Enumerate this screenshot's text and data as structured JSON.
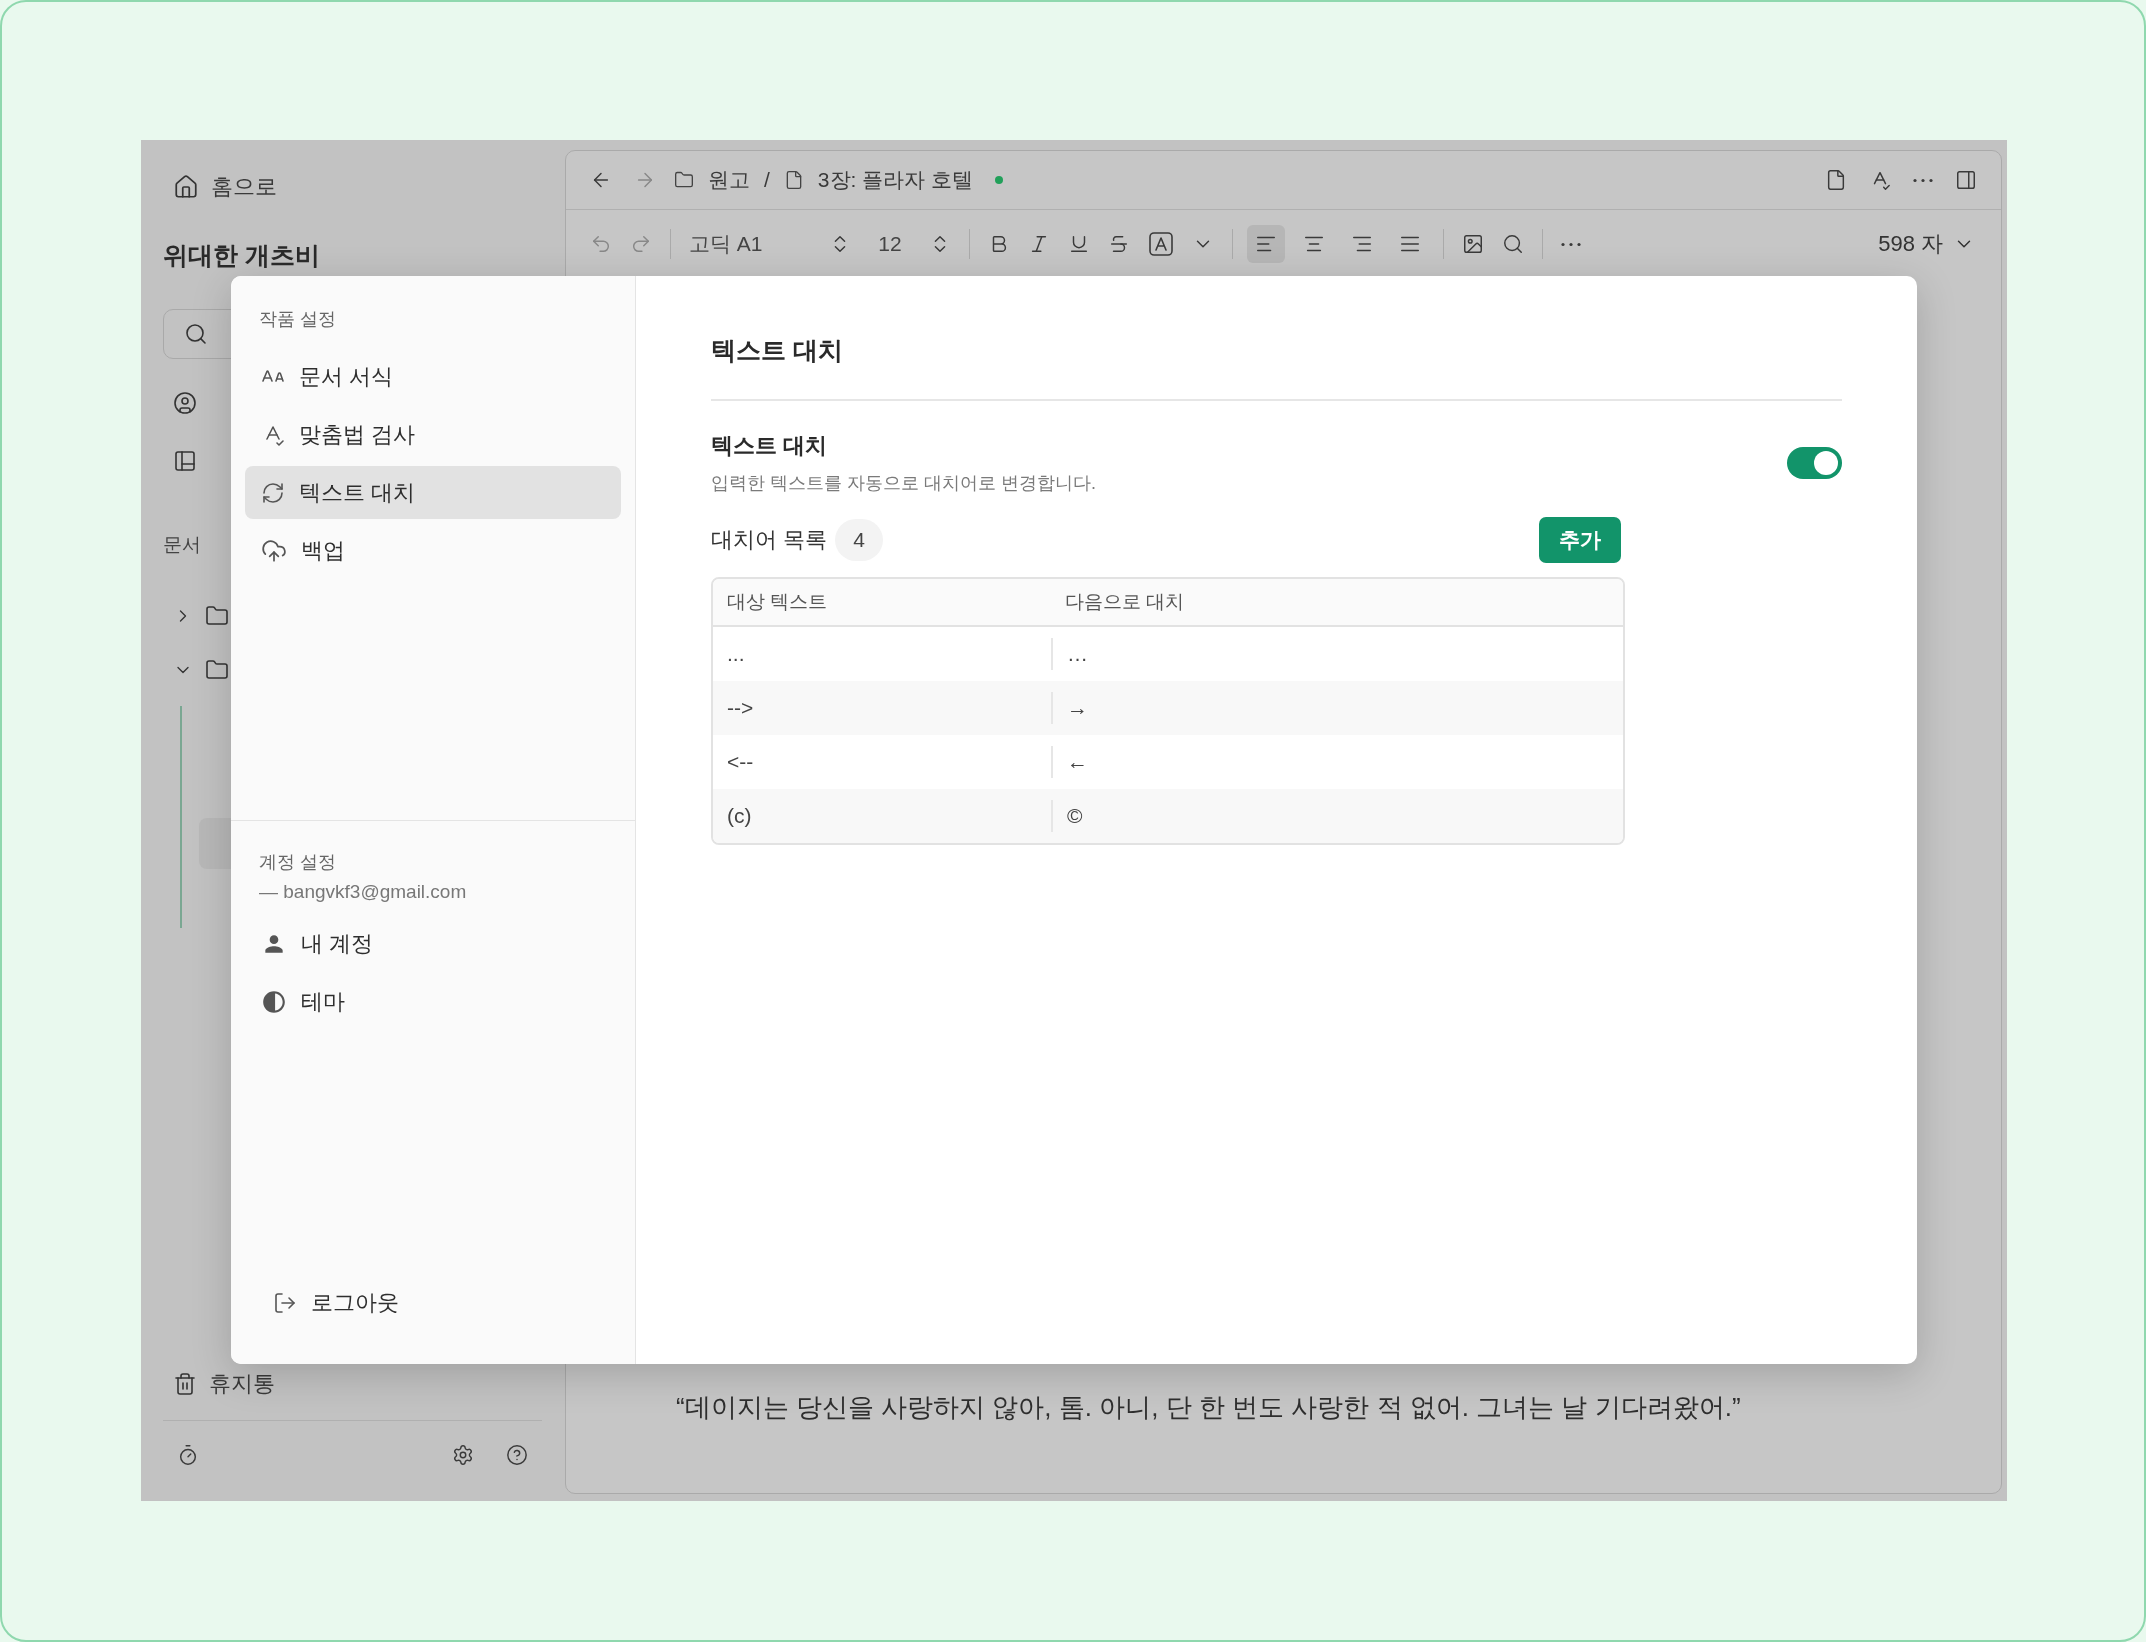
{
  "sidebar": {
    "home_label": "홈으로",
    "project_title": "위대한 개츠비",
    "section_label": "문서",
    "trash_label": "휴지통"
  },
  "editor": {
    "breadcrumb": [
      {
        "kind": "folder",
        "label": "원고"
      },
      {
        "kind": "file",
        "label": "3장: 플라자 호텔"
      }
    ],
    "breadcrumb_separator": "/",
    "saved": true,
    "toolbar": {
      "font": "고딕 A1",
      "size": "12",
      "alignments": [
        {
          "kind": "left",
          "selected": true
        },
        {
          "kind": "center",
          "selected": false
        },
        {
          "kind": "right",
          "selected": false
        },
        {
          "kind": "justify",
          "selected": false
        }
      ]
    },
    "word_count": "598 자",
    "body_text": "“데이지는 당신을 사랑하지 않아, 톰. 아니, 단 한 번도 사랑한 적 없어. 그녀는 날 기다려왔어.”"
  },
  "settings": {
    "work_heading": "작품 설정",
    "work_items": [
      {
        "kind": "format",
        "label": "문서 서식",
        "selected": false
      },
      {
        "kind": "spellcheck",
        "label": "맞춤법 검사",
        "selected": false
      },
      {
        "kind": "replace",
        "label": "텍스트 대치",
        "selected": true
      },
      {
        "kind": "backup",
        "label": "백업",
        "selected": false
      }
    ],
    "account_heading": "계정 설정",
    "account_email": "— bangvkf3@gmail.com",
    "account_items": [
      {
        "kind": "account",
        "label": "내 계정",
        "selected": false
      },
      {
        "kind": "theme",
        "label": "테마",
        "selected": false
      }
    ],
    "logout_label": "로그아웃",
    "page": {
      "title": "텍스트 대치",
      "setting_title": "텍스트 대치",
      "setting_description": "입력한 텍스트를 자동으로 대치어로 변경합니다.",
      "enabled": true,
      "list_label": "대치어 목록",
      "count": "4",
      "add_button": "추가",
      "columns": [
        "대상 텍스트",
        "다음으로 대치"
      ],
      "rows": [
        {
          "target": "...",
          "replacement": "…"
        },
        {
          "target": "-->",
          "replacement": "→"
        },
        {
          "target": "<--",
          "replacement": "←"
        },
        {
          "target": "(c)",
          "replacement": "©"
        }
      ]
    }
  }
}
